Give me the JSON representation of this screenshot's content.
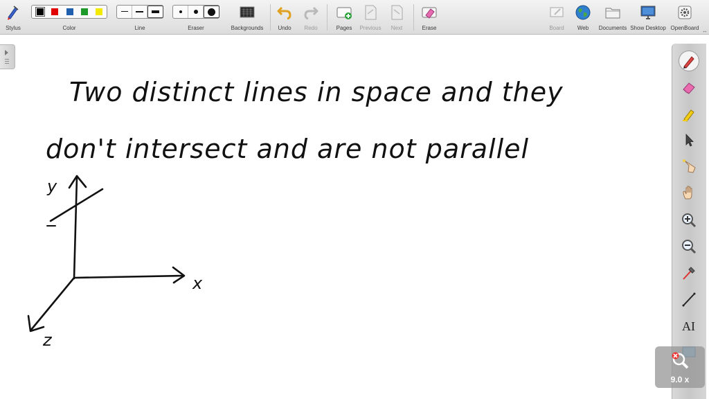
{
  "toolbar": {
    "stylus_label": "Stylus",
    "color_label": "Color",
    "line_label": "Line",
    "eraser_label": "Eraser",
    "backgrounds_label": "Backgrounds",
    "undo_label": "Undo",
    "redo_label": "Redo",
    "pages_label": "Pages",
    "previous_label": "Previous",
    "next_label": "Next",
    "erase_label": "Erase",
    "board_label": "Board",
    "web_label": "Web",
    "documents_label": "Documents",
    "show_desktop_label": "Show Desktop",
    "openboard_label": "OpenBoard",
    "colors": [
      "#000000",
      "#e00000",
      "#1f5fae",
      "#1d9a2a",
      "#f4ea00"
    ]
  },
  "board": {
    "line1": "Two distinct lines in space and they",
    "line2": "don't intersect and are not parallel",
    "axis_y": "y",
    "axis_x": "x",
    "axis_z": "z"
  },
  "zoom": {
    "label": "9.0 x"
  }
}
